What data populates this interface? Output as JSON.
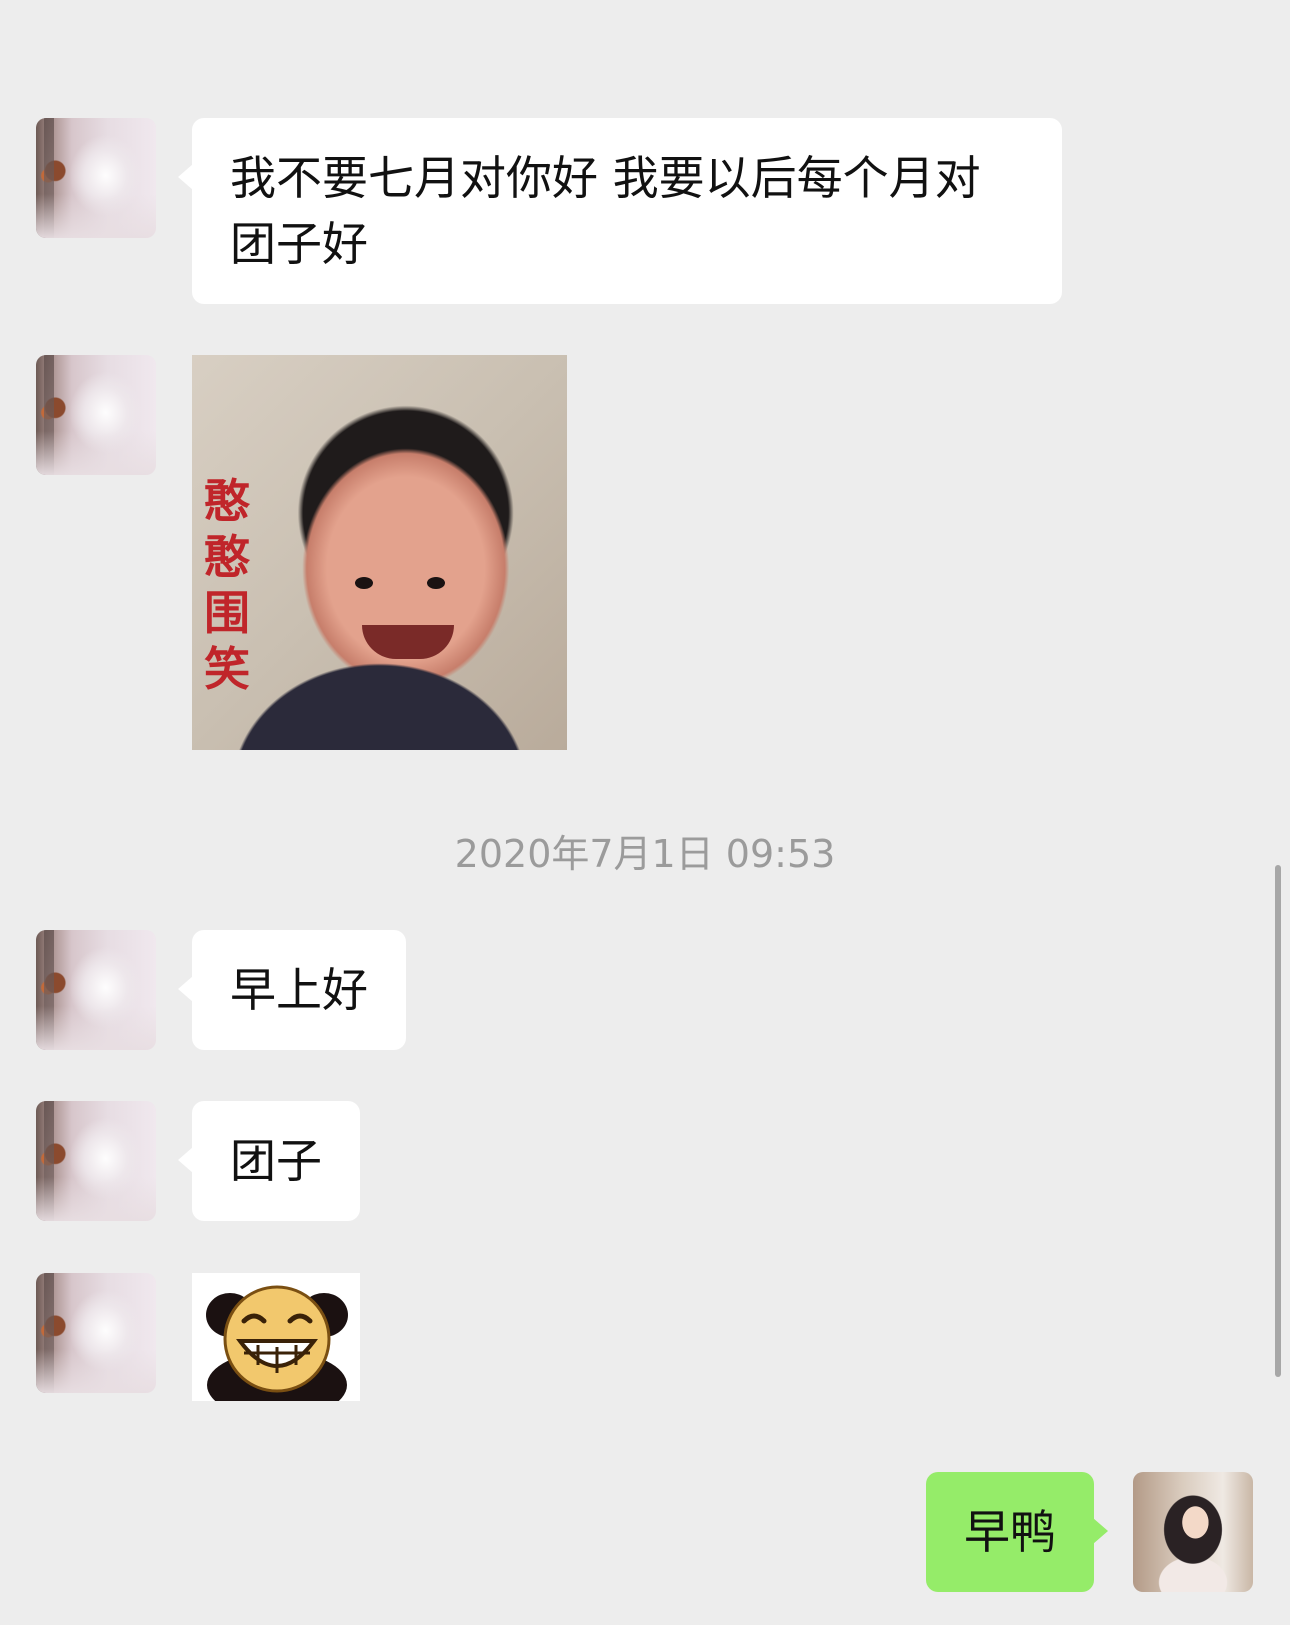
{
  "messages": [
    {
      "side": "left",
      "type": "text",
      "text": "我不要七月对你好 我要以后每个月对团子好"
    },
    {
      "side": "left",
      "type": "image",
      "caption": "憨憨围笑"
    },
    {
      "side": "left",
      "type": "text",
      "text": "早上好"
    },
    {
      "side": "left",
      "type": "text",
      "text": "团子"
    },
    {
      "side": "left",
      "type": "sticker",
      "icon": "grinning-panda-emoji"
    },
    {
      "side": "right",
      "type": "text",
      "text": "早鸭"
    }
  ],
  "timestamp": "2020年7月1日 09:53",
  "colors": {
    "background": "#ededed",
    "incoming_bubble": "#ffffff",
    "outgoing_bubble": "#95ec69",
    "timestamp_text": "#9b9b9b",
    "caption_red": "#c0252a"
  }
}
